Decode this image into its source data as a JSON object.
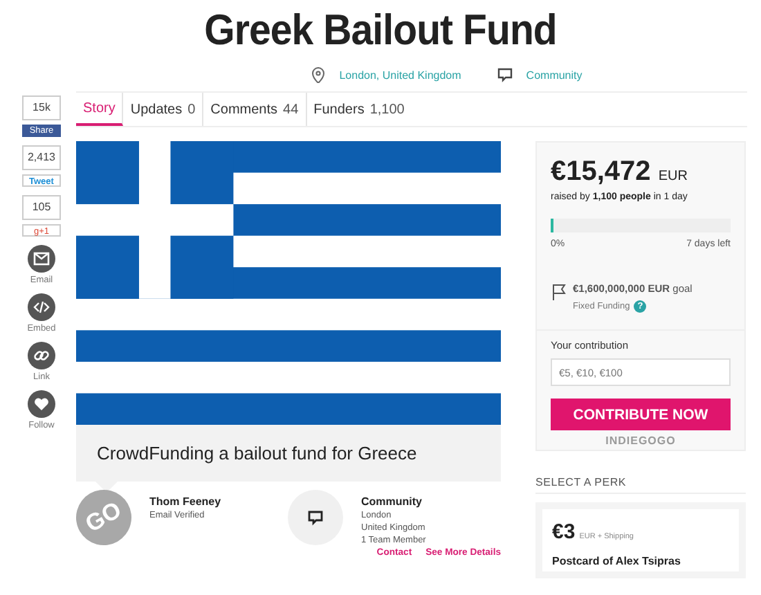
{
  "title": "Greek Bailout Fund",
  "meta": [
    {
      "kind": "location",
      "text": "London, United Kingdom"
    },
    {
      "kind": "category",
      "text": "Community"
    }
  ],
  "share": {
    "counters": [
      {
        "kind": "facebook",
        "count": "15k",
        "label": "Share"
      },
      {
        "kind": "twitter",
        "count": "2,413",
        "label": "Tweet"
      },
      {
        "kind": "google",
        "count": "105",
        "label": "g+1"
      }
    ],
    "actions": [
      {
        "kind": "email",
        "label": "Email"
      },
      {
        "kind": "embed",
        "label": "Embed"
      },
      {
        "kind": "link",
        "label": "Link"
      },
      {
        "kind": "follow",
        "label": "Follow"
      }
    ]
  },
  "tabs": [
    {
      "label": "Story",
      "selected": true
    },
    {
      "label": "Updates",
      "count": "0",
      "selected": false
    },
    {
      "label": "Comments",
      "count": "44",
      "selected": false
    },
    {
      "label": "Funders",
      "count": "1,100",
      "selected": false
    }
  ],
  "campaign": {
    "tagline": "CrowdFunding a bailout fund for Greece"
  },
  "owner": {
    "avatar_text": "GO",
    "name": "Thom Feeney",
    "status": "Email Verified"
  },
  "team": {
    "name": "Community",
    "lines": [
      "London",
      "United Kingdom",
      "1 Team Member"
    ]
  },
  "links": [
    "Contact",
    "See More Details"
  ],
  "funding": {
    "amount": "€15,472",
    "currency": "EUR",
    "raised": "raised by **1,100 people** in 1 day",
    "level": 0.01,
    "percent": "0%",
    "time_left": "7 days left",
    "goal": "**€1,600,000,000 EUR** goal",
    "funding_type": "Fixed Funding",
    "help": "?"
  },
  "contribution": {
    "label": "Your contribution",
    "placeholder": "€5, €10, €100",
    "button": "CONTRIBUTE NOW",
    "brand": "INDIEGOGO"
  },
  "perks": {
    "heading": "SELECT A PERK",
    "items": [
      {
        "price": "€3",
        "note": "EUR + Shipping",
        "title": "Postcard of Alex Tsipras"
      }
    ]
  }
}
